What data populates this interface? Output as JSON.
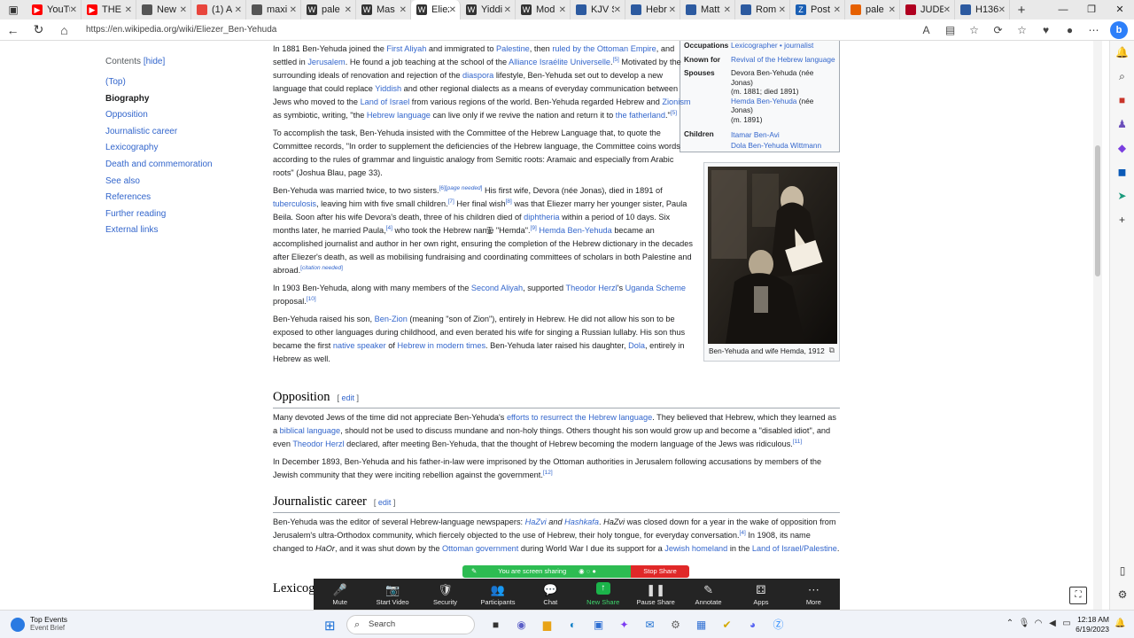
{
  "browser": {
    "tabs": [
      {
        "label": "",
        "favicon": "window-menu"
      },
      {
        "label": "YouTu",
        "color": "#ff0000",
        "icon": "youtube-icon"
      },
      {
        "label": "THE",
        "color": "#ff0000",
        "icon": "youtube-icon"
      },
      {
        "label": "New",
        "color": "#555555",
        "icon": "page-icon"
      },
      {
        "label": "(1) A",
        "color": "#e8453c",
        "icon": "app-icon"
      },
      {
        "label": "maxi",
        "color": "#555555",
        "icon": "doc-icon"
      },
      {
        "label": "pale",
        "color": "#333333",
        "icon": "wikipedia-icon"
      },
      {
        "label": "Mas",
        "color": "#333333",
        "icon": "wikipedia-icon"
      },
      {
        "label": "Eliez",
        "color": "#333333",
        "icon": "wikipedia-icon",
        "active": true
      },
      {
        "label": "Yiddi",
        "color": "#333333",
        "icon": "wikipedia-icon"
      },
      {
        "label": "Mod",
        "color": "#333333",
        "icon": "wikipedia-icon"
      },
      {
        "label": "KJV S",
        "color": "#2c5aa0",
        "icon": "bible-icon"
      },
      {
        "label": "Hebr",
        "color": "#2c5aa0",
        "icon": "bible-icon"
      },
      {
        "label": "Matt",
        "color": "#2c5aa0",
        "icon": "bible-icon"
      },
      {
        "label": "Rom",
        "color": "#2c5aa0",
        "icon": "bible-icon"
      },
      {
        "label": "Post",
        "color": "#1a5fb4",
        "icon": "z-icon"
      },
      {
        "label": "pale",
        "color": "#e66000",
        "icon": "app-icon"
      },
      {
        "label": "JUDE",
        "color": "#b00020",
        "icon": "book-icon"
      },
      {
        "label": "H136",
        "color": "#2c5aa0",
        "icon": "bible-icon"
      }
    ],
    "url": "https://en.wikipedia.org/wiki/Eliezer_Ben-Yehuda"
  },
  "toc": {
    "title": "Contents",
    "hide": "[hide]",
    "items": [
      "(Top)",
      "Biography",
      "Opposition",
      "Journalistic career",
      "Lexicography",
      "Death and commemoration",
      "See also",
      "References",
      "Further reading",
      "External links"
    ]
  },
  "infobox": {
    "occupations_label": "Occupations",
    "occupations": "Lexicographer • journalist",
    "known_for_label": "Known for",
    "known_for": "Revival of the Hebrew language",
    "spouses_label": "Spouses",
    "spouse1_name": "Devora Ben-Yehuda (née Jonas)",
    "spouse1_dates": "(m. 1881; died 1891)",
    "spouse2_name": "Hemda Ben-Yehuda",
    "spouse2_extra": "(née Jonas)",
    "spouse2_dates": "(m. 1891)",
    "children_label": "Children",
    "child1": "Itamar Ben-Avi",
    "child2": "Dola Ben-Yehuda Wittmann"
  },
  "photo": {
    "caption": "Ben-Yehuda and wife Hemda, 1912"
  },
  "sections": {
    "opposition": {
      "title": "Opposition",
      "edit": "edit"
    },
    "journalistic": {
      "title": "Journalistic career",
      "edit": "edit"
    },
    "lexicography": {
      "title": "Lexicog"
    }
  },
  "zoom": {
    "sharing": "You are screen sharing",
    "stop": "Stop Share",
    "buttons": [
      "Mute",
      "Start Video",
      "Security",
      "Participants",
      "Chat",
      "New Share",
      "Pause Share",
      "Annotate",
      "Apps",
      "More"
    ]
  },
  "taskbar": {
    "news_title": "Top Events",
    "news_sub": "Event Brief",
    "search": "Search",
    "time": "12:18 AM",
    "date": "6/19/2023"
  }
}
